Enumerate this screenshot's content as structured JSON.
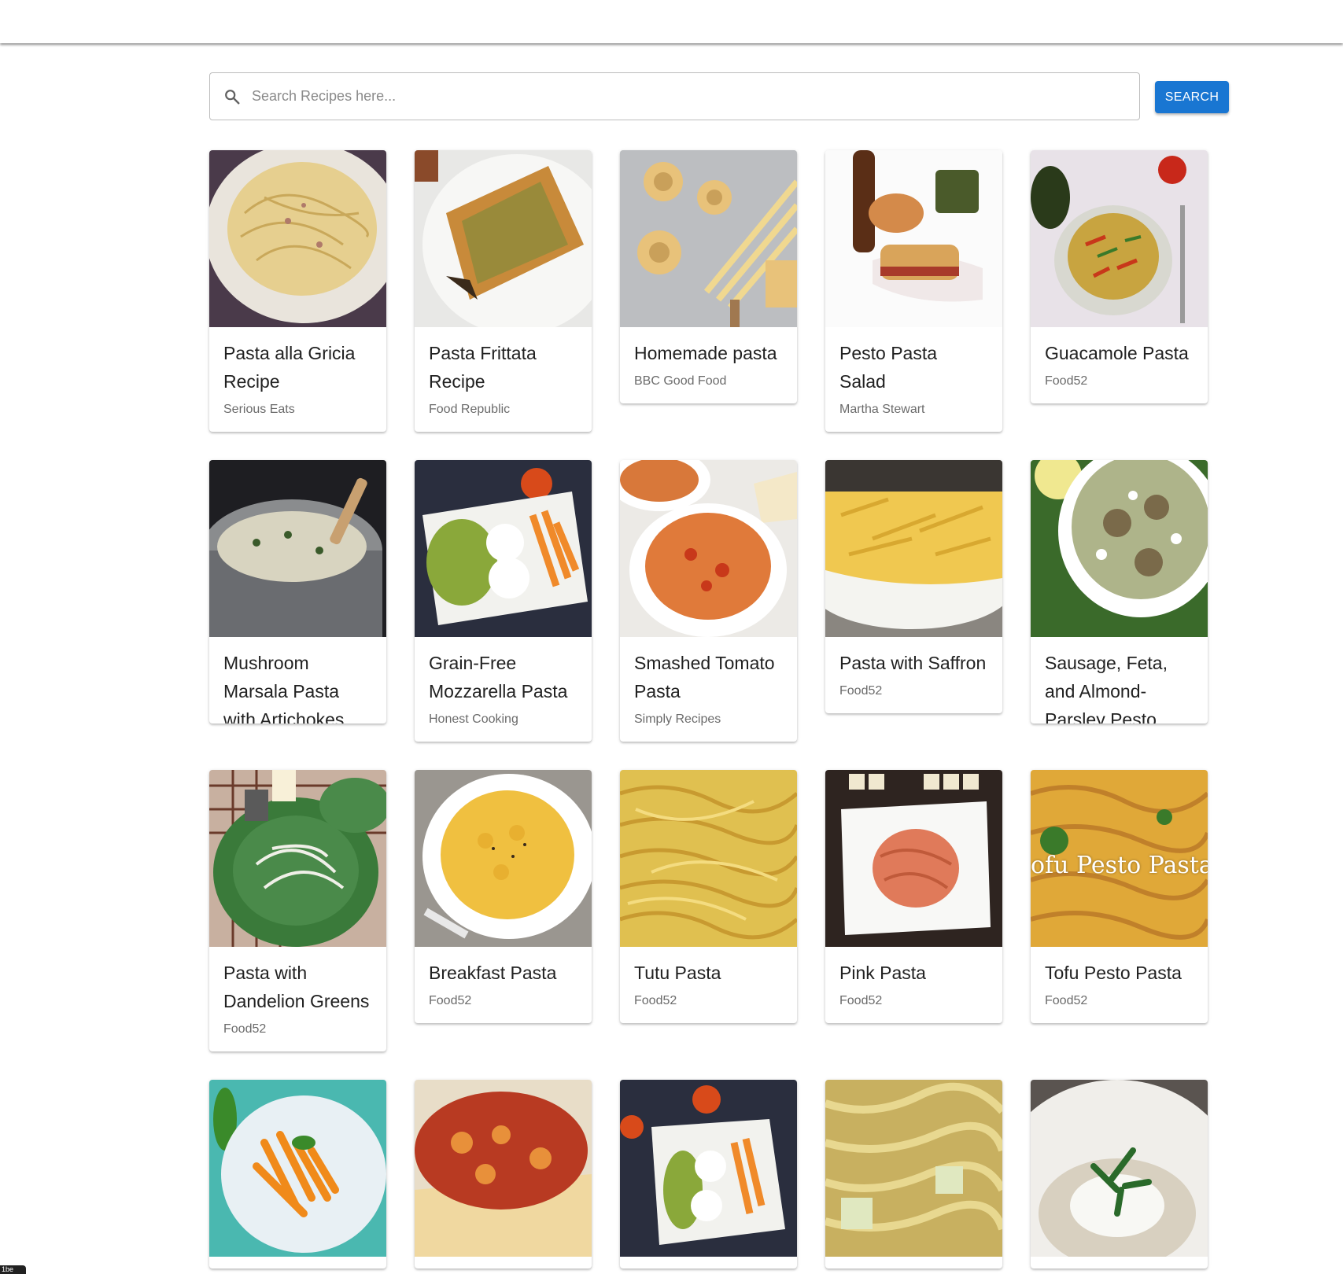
{
  "search": {
    "placeholder": "Search Recipes here...",
    "button_label": "SEARCH"
  },
  "colors": {
    "accent": "#1976d2"
  },
  "recipes": [
    {
      "title": "Pasta alla Gricia Recipe",
      "source": "Serious Eats",
      "image": "spaghetti-carbonara-plate"
    },
    {
      "title": "Pasta Frittata Recipe",
      "source": "Food Republic",
      "image": "frittata-wedge-plate"
    },
    {
      "title": "Homemade pasta",
      "source": "BBC Good Food",
      "image": "fresh-pasta-nests-flour"
    },
    {
      "title": "Pesto Pasta Salad",
      "source": "Martha Stewart",
      "image": "sandwich-bottle-olives"
    },
    {
      "title": "Guacamole Pasta",
      "source": "Food52",
      "image": "penne-bowl-avocado"
    },
    {
      "title": "Mushroom Marsala Pasta with Artichokes",
      "source": "",
      "image": "pasta-in-pot"
    },
    {
      "title": "Grain-Free Mozzarella Pasta",
      "source": "Honest Cooking",
      "image": "fusilli-mozzarella-plate"
    },
    {
      "title": "Smashed Tomato Pasta",
      "source": "Simply Recipes",
      "image": "fusilli-tomato-bowl"
    },
    {
      "title": "Pasta with Saffron",
      "source": "Food52",
      "image": "penne-saffron-bowl"
    },
    {
      "title": "Sausage, Feta, and Almond-Parsley Pesto",
      "source": "",
      "image": "orzo-sausage-feta-bowl"
    },
    {
      "title": "Pasta with Dandelion Greens",
      "source": "Food52",
      "image": "spaghetti-greens-green-bowl"
    },
    {
      "title": "Breakfast Pasta",
      "source": "Food52",
      "image": "cavatappi-cheese-bowl"
    },
    {
      "title": "Tutu Pasta",
      "source": "Food52",
      "image": "spaghetti-closeup"
    },
    {
      "title": "Pink Pasta",
      "source": "Food52",
      "image": "pink-spaghetti-plate"
    },
    {
      "title": "Tofu Pesto Pasta",
      "source": "Food52",
      "image": "tofu-pesto-linguine",
      "overlay_text": "ofu Pesto Pasta"
    },
    {
      "title": "",
      "source": "",
      "image": "penne-arrabbiata-plate"
    },
    {
      "title": "",
      "source": "",
      "image": "pappardelle-tomato-sauce"
    },
    {
      "title": "",
      "source": "",
      "image": "fusilli-mozzarella-plate-dark"
    },
    {
      "title": "",
      "source": "",
      "image": "cabbage-noodles"
    },
    {
      "title": "",
      "source": "",
      "image": "risotto-parsley-bowl"
    }
  ],
  "corner_chip": {
    "label": "1be"
  }
}
